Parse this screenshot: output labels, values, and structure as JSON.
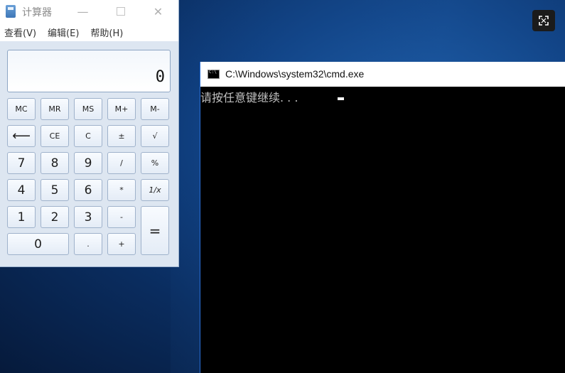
{
  "calculator": {
    "title": "计算器",
    "menu": [
      "查看(V)",
      "编辑(E)",
      "帮助(H)"
    ],
    "display": "0",
    "keys": {
      "mc": "MC",
      "mr": "MR",
      "ms": "MS",
      "mplus": "M+",
      "mminus": "M-",
      "backspace": "⟵",
      "ce": "CE",
      "c": "C",
      "plusminus": "±",
      "sqrt": "√",
      "k7": "7",
      "k8": "8",
      "k9": "9",
      "div": "/",
      "pct": "%",
      "k4": "4",
      "k5": "5",
      "k6": "6",
      "mul": "*",
      "recip": "1/x",
      "k1": "1",
      "k2": "2",
      "k3": "3",
      "sub": "-",
      "eq": "=",
      "k0": "0",
      "dot": ".",
      "add": "+"
    }
  },
  "cmd": {
    "title": "C:\\Windows\\system32\\cmd.exe",
    "output": "请按任意键继续. . ."
  }
}
